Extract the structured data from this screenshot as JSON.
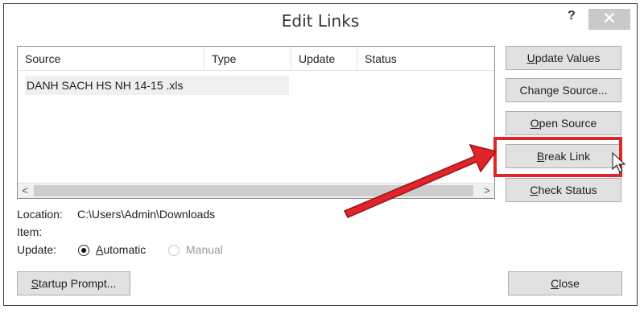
{
  "dialog": {
    "title": "Edit Links",
    "help_label": "?",
    "close_glyph": "✕"
  },
  "list": {
    "columns": [
      "Source",
      "Type",
      "Update",
      "Status"
    ],
    "rows": [
      {
        "source": "DANH SACH HS NH 14-15 .xls",
        "type": "",
        "update": "",
        "status": ""
      }
    ],
    "scroll_left": "<",
    "scroll_right": ">"
  },
  "buttons": {
    "update_values": {
      "pre": "",
      "key": "U",
      "post": "pdate Values"
    },
    "change_source": {
      "pre": "Chan",
      "key": "g",
      "post": "e Source..."
    },
    "open_source": {
      "pre": "",
      "key": "O",
      "post": "pen Source"
    },
    "break_link": {
      "pre": "",
      "key": "B",
      "post": "reak Link"
    },
    "check_status": {
      "pre": "",
      "key": "C",
      "post": "heck Status"
    },
    "startup_prompt": {
      "pre": "",
      "key": "S",
      "post": "tartup Prompt..."
    },
    "close": {
      "pre": "",
      "key": "C",
      "post": "lose"
    }
  },
  "info": {
    "location_label": "Location:",
    "location_value": "C:\\Users\\Admin\\Downloads",
    "item_label": "Item:",
    "update_label": "Update:",
    "automatic": {
      "pre": "",
      "key": "A",
      "post": "utomatic"
    },
    "manual": "Manual",
    "update_mode": "Automatic"
  },
  "colors": {
    "highlight": "#e0242a",
    "arrow": "#e0242a"
  }
}
